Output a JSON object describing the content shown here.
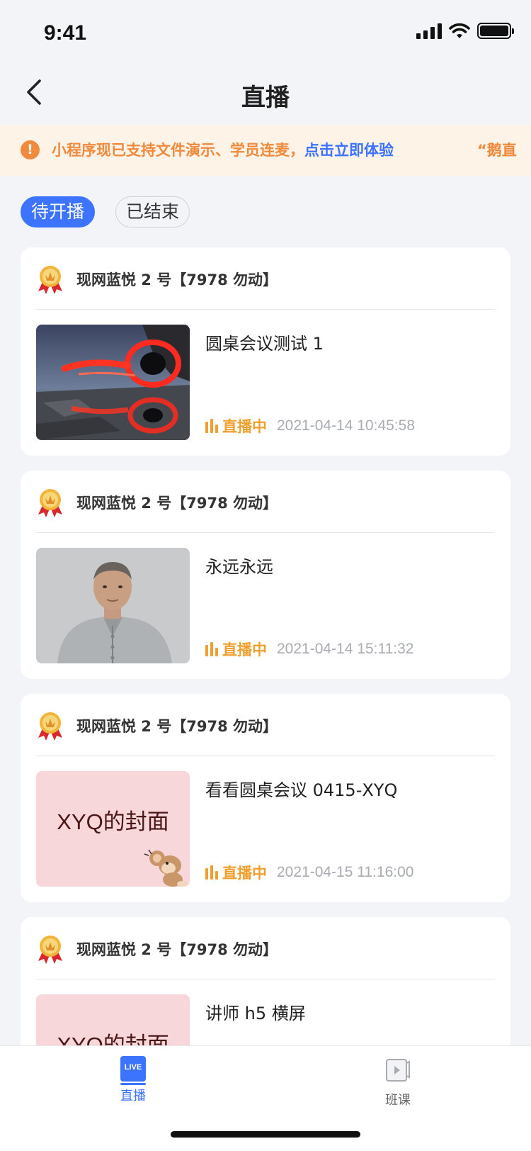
{
  "status_bar": {
    "time": "9:41"
  },
  "nav": {
    "title": "直播"
  },
  "notice": {
    "text": "小程序现已支持文件演示、学员连麦，",
    "link": "点击立即体验",
    "tail": "“鹅直"
  },
  "tabs": [
    {
      "label": "待开播",
      "active": true
    },
    {
      "label": "已结束",
      "active": false
    }
  ],
  "cards": [
    {
      "org": "现网蓝悦 2 号【7978 勿动】",
      "title": "圆桌会议测试 1",
      "status": "直播中",
      "time": "2021-04-14 10:45:58",
      "thumb": "red-light-painting-photo"
    },
    {
      "org": "现网蓝悦 2 号【7978 勿动】",
      "title": "永远永远",
      "status": "直播中",
      "time": "2021-04-14 15:11:32",
      "thumb": "portrait-photo"
    },
    {
      "org": "现网蓝悦 2 号【7978 勿动】",
      "title": "看看圆桌会议 0415-XYQ",
      "status": "直播中",
      "time": "2021-04-15 11:16:00",
      "thumb": "pink-cover",
      "cover_text": "XYQ的封面"
    },
    {
      "org": "现网蓝悦 2 号【7978 勿动】",
      "title": "讲师 h5 横屏",
      "status": "",
      "time": "",
      "thumb": "pink-cover",
      "cover_text": "XYQ的封面"
    }
  ],
  "tab_bar": {
    "items": [
      {
        "label": "直播",
        "icon": "live-icon",
        "badge": "LIVE",
        "active": true
      },
      {
        "label": "班课",
        "icon": "video-class-icon",
        "active": false
      }
    ]
  },
  "colors": {
    "accent": "#3d74ff",
    "live": "#f0a030",
    "notice_bg": "#fdf3e6",
    "notice_text": "#f08a3c"
  }
}
